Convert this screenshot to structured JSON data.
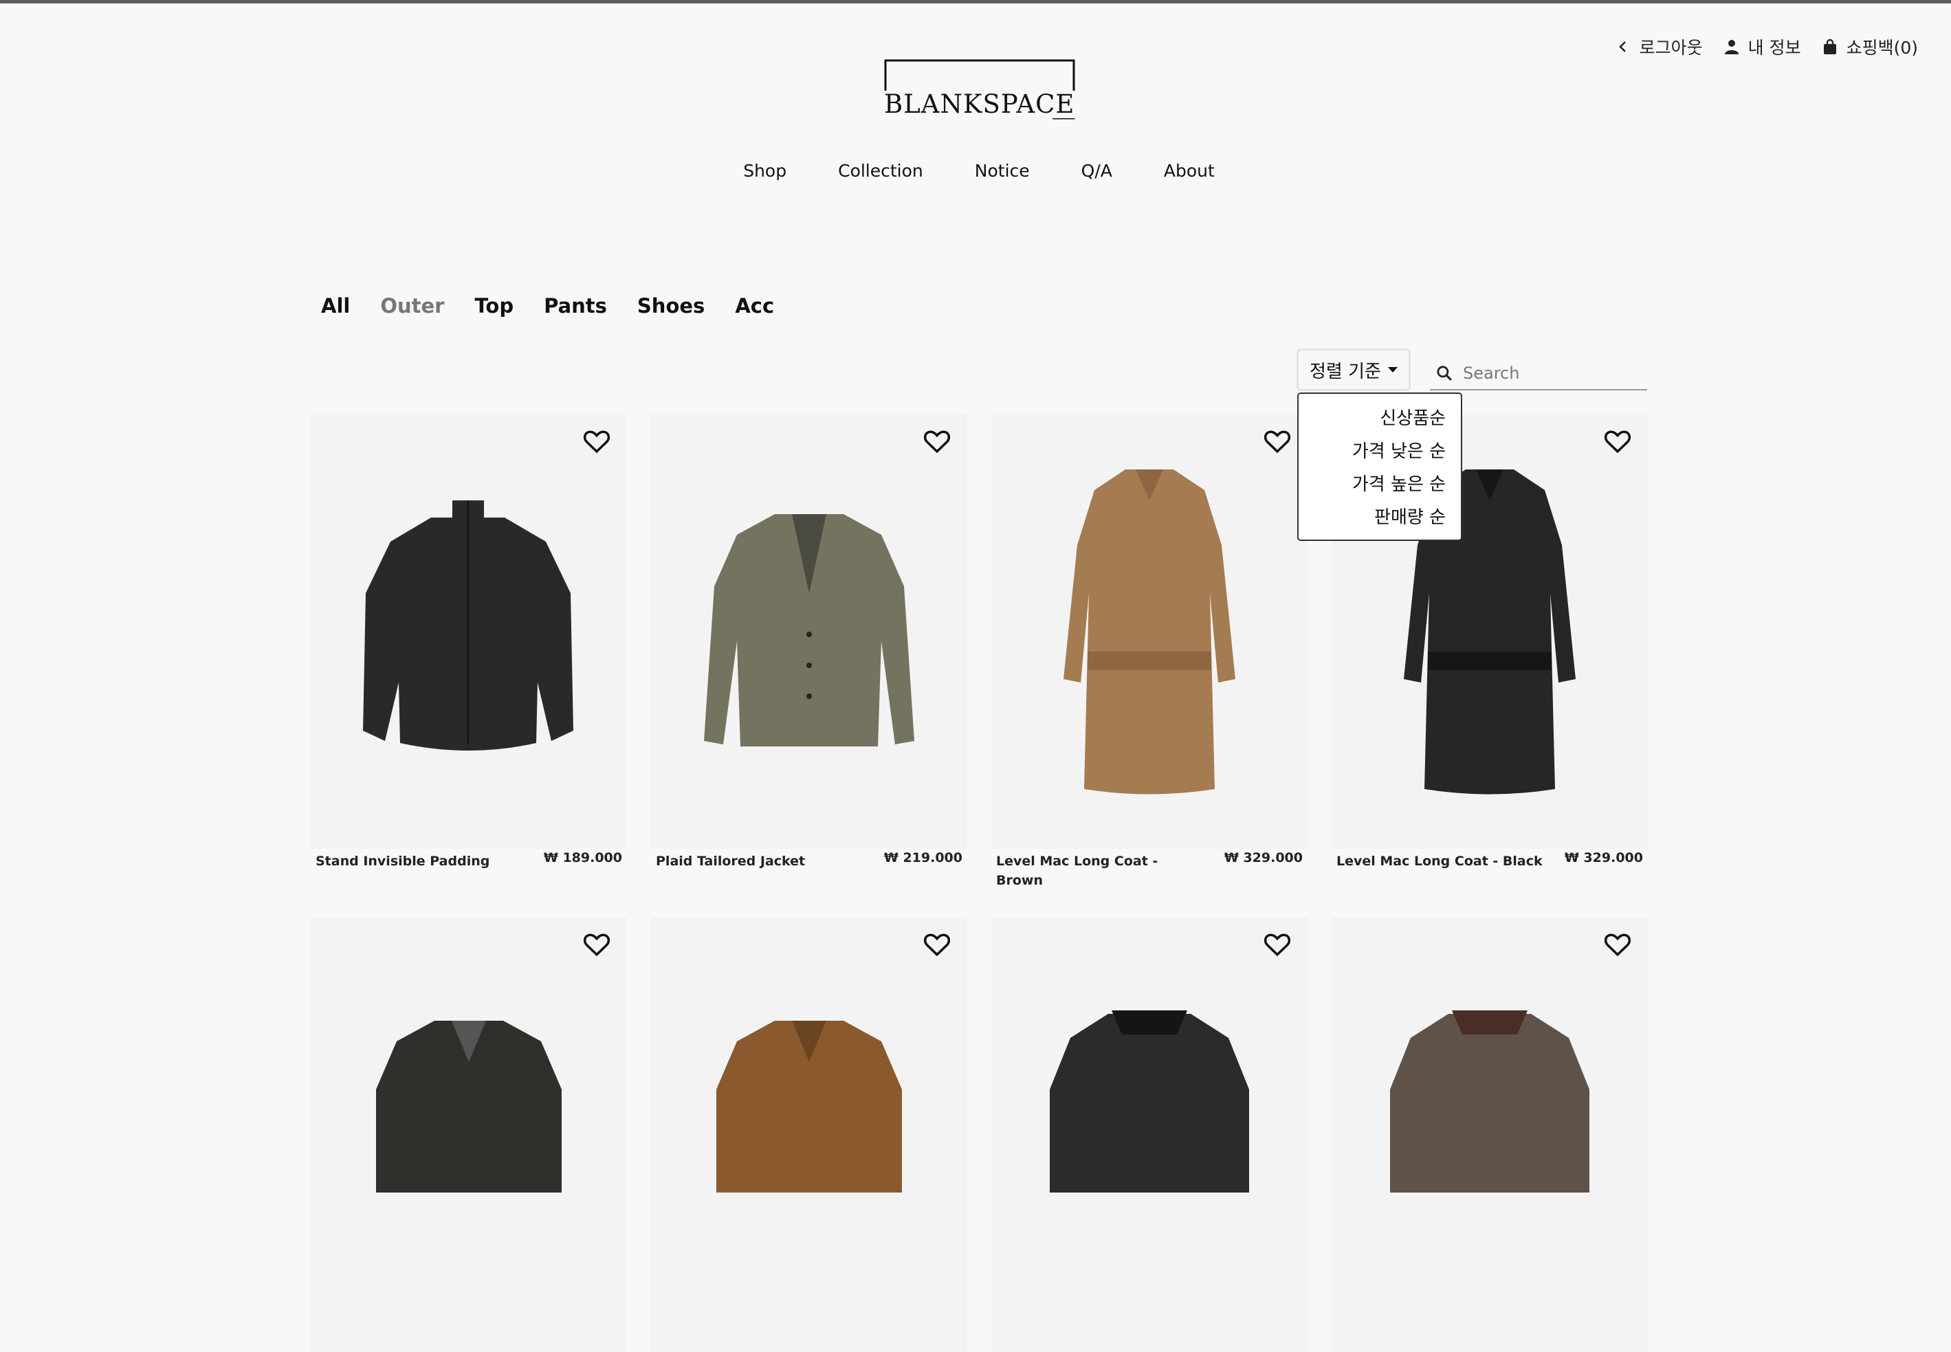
{
  "header": {
    "logout": "로그아웃",
    "my_info": "내 정보",
    "cart": "쇼핑백(0)",
    "logo": "BLANKSPACE"
  },
  "main_nav": [
    "Shop",
    "Collection",
    "Notice",
    "Q/A",
    "About"
  ],
  "categories": {
    "items": [
      "All",
      "Outer",
      "Top",
      "Pants",
      "Shoes",
      "Acc"
    ],
    "active": "Outer"
  },
  "toolbar": {
    "sort_label": "정렬 기준",
    "search_placeholder": "Search",
    "sort_options": [
      "신상품순",
      "가격 낮은 순",
      "가격 높은 순",
      "판매량 순"
    ]
  },
  "products": [
    {
      "name": "Stand Invisible Padding",
      "price": "₩ 189.000",
      "color": "#2a2927"
    },
    {
      "name": "Plaid Tailored Jacket",
      "price": "₩ 219.000",
      "color": "#74735f"
    },
    {
      "name": "Level Mac Long Coat - Brown",
      "price": "₩ 329.000",
      "color": "#a57b52"
    },
    {
      "name": "Level Mac Long Coat - Black",
      "price": "₩ 329.000",
      "color": "#262626"
    },
    {
      "color": "#2f302c"
    },
    {
      "color": "#8a5a2e"
    },
    {
      "color": "#2a2b2c"
    },
    {
      "color": "#5e5249"
    }
  ]
}
